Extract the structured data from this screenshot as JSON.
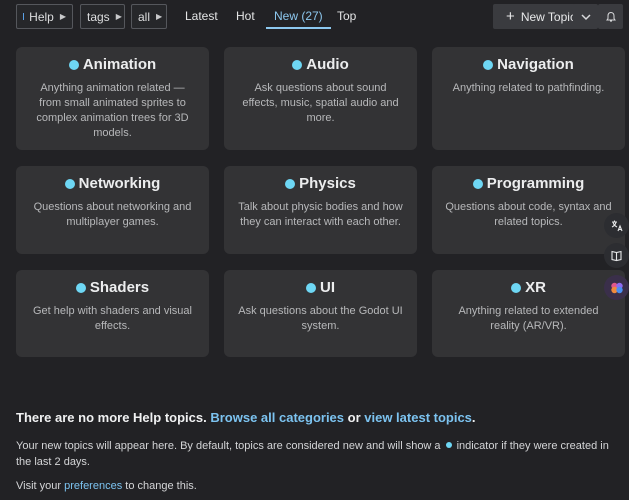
{
  "nav": {
    "category_label": "Help",
    "tags_label": "tags",
    "all_label": "all",
    "tabs": [
      {
        "label": "Latest"
      },
      {
        "label": "Hot"
      },
      {
        "label": "New (27)"
      },
      {
        "label": "Top"
      }
    ],
    "new_topic_label": "New Topic"
  },
  "categories": [
    {
      "title": "Animation",
      "description": "Anything animation related — from small animated sprites to complex animation trees for 3D models."
    },
    {
      "title": "Audio",
      "description": "Ask questions about sound effects, music, spatial audio and more."
    },
    {
      "title": "Navigation",
      "description": "Anything related to pathfinding."
    },
    {
      "title": "Networking",
      "description": "Questions about networking and multiplayer games."
    },
    {
      "title": "Physics",
      "description": "Talk about physic bodies and how they can interact with each other."
    },
    {
      "title": "Programming",
      "description": "Questions about code, syntax and related topics."
    },
    {
      "title": "Shaders",
      "description": "Get help with shaders and visual effects."
    },
    {
      "title": "UI",
      "description": "Ask questions about the Godot UI system."
    },
    {
      "title": "XR",
      "description": "Anything related to extended reality (AR/VR)."
    }
  ],
  "footer": {
    "no_more": "There are no more Help topics.",
    "browse_link": "Browse all categories",
    "or": "or",
    "latest_link": "view latest topics",
    "period": ".",
    "info_before": "Your new topics will appear here. By default, topics are considered new and will show a",
    "info_after": "indicator if they were created in the last 2 days.",
    "visit_before": "Visit your",
    "preferences_link": "preferences",
    "visit_after": "to change this."
  },
  "colors": {
    "background": "#222225",
    "card": "#333335",
    "accent": "#6ed7f4",
    "link": "#7cc3f0"
  }
}
